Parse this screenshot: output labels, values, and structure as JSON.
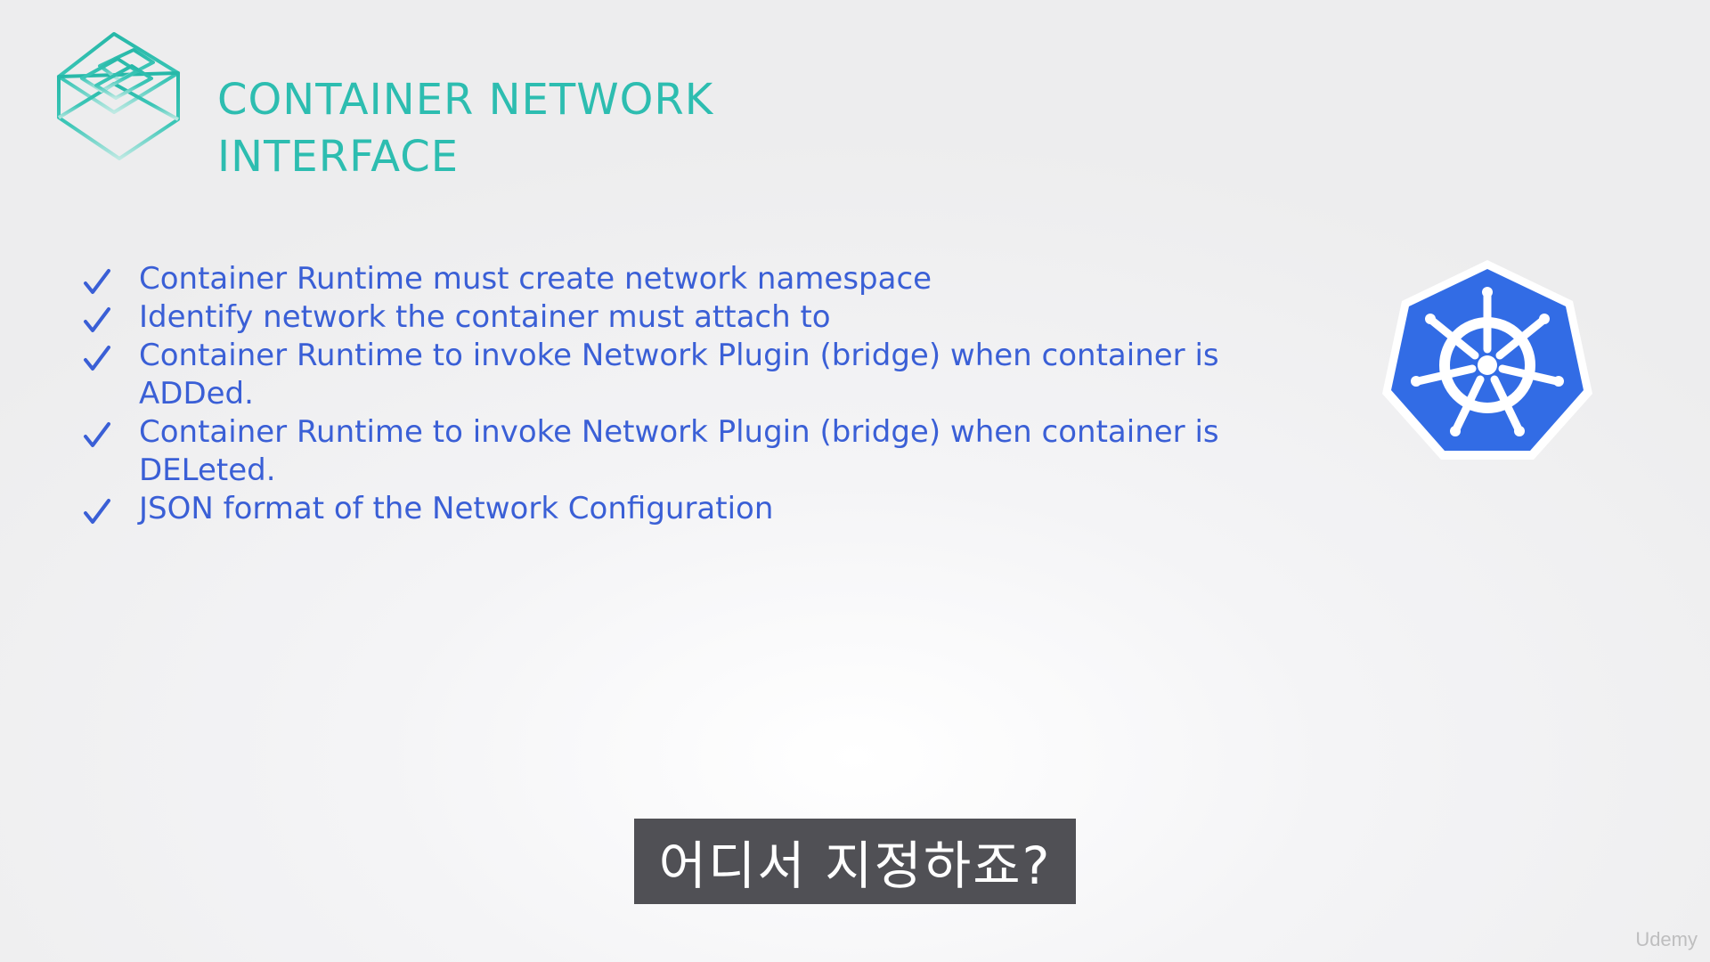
{
  "slide": {
    "title_line1": "CONTAINER NETWORK",
    "title_line2": "INTERFACE",
    "bullets": [
      {
        "text": "Container Runtime must create network namespace"
      },
      {
        "text": "Identify network the container must attach to"
      },
      {
        "text": "Container Runtime to invoke Network Plugin (bridge) when container is ADDed."
      },
      {
        "text": "Container Runtime to invoke Network Plugin (bridge) when container is DELeted."
      },
      {
        "text": "JSON format of the Network Configuration"
      }
    ]
  },
  "icons": {
    "title_logo": "cni-cube-logo-icon",
    "bullet_marker": "check-icon",
    "side_logo": "kubernetes-helm-icon"
  },
  "subtitle": {
    "text": "어디서 지정하죠?"
  },
  "watermark": {
    "text": "Udemy"
  },
  "colors": {
    "title": "#2dbdb0",
    "bullet_text": "#3a5fd6",
    "kubernetes_blue": "#326ce5",
    "subtitle_bg": "#505055"
  }
}
